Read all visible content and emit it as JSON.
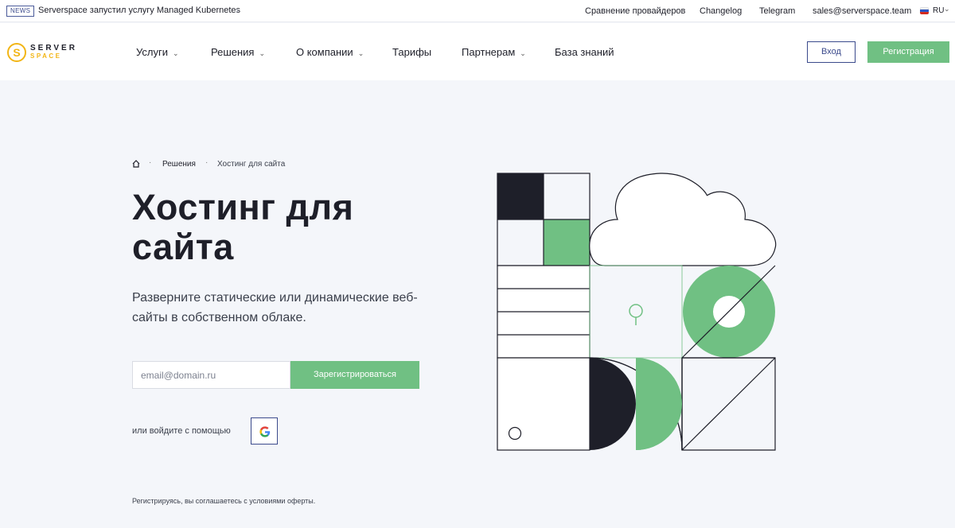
{
  "topbar": {
    "news_badge": "NEWS",
    "news_text": "Serverspace запустил услугу Managed Kubernetes",
    "links": [
      "Сравнение провайдеров",
      "Changelog",
      "Telegram",
      "sales@serverspace.team"
    ],
    "lang": "RU"
  },
  "header": {
    "logo_top": "SERVER",
    "logo_bottom": "SPACE",
    "nav": [
      "Услуги",
      "Решения",
      "О компании",
      "Тарифы",
      "Партнерам",
      "База знаний"
    ],
    "login": "Вход",
    "register": "Регистрация"
  },
  "breadcrumb": {
    "items": [
      "Решения",
      "Хостинг для сайта"
    ]
  },
  "hero": {
    "title": "Хостинг для сайта",
    "lead": "Разверните статические или динамические веб-сайты в собственном облаке.",
    "email_placeholder": "email@domain.ru",
    "signup_button": "Зарегистрироваться",
    "alt_login_text": "или войдите с помощью",
    "terms": "Регистрируясь, вы соглашаетесь с условиями оферты."
  },
  "colors": {
    "accent_green": "#70c083",
    "brand_blue": "#3b4a8c",
    "logo_yellow": "#f2b515",
    "dark": "#1e1f29"
  }
}
